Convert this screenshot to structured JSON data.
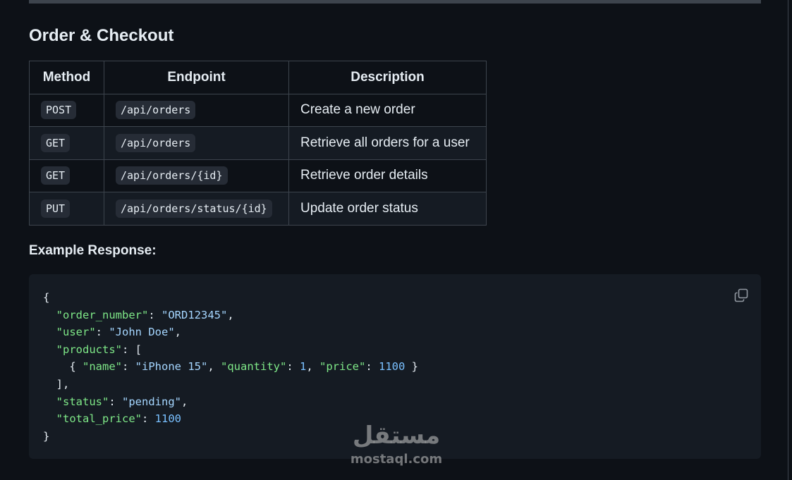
{
  "section": {
    "title": "Order & Checkout"
  },
  "table": {
    "headers": [
      "Method",
      "Endpoint",
      "Description"
    ],
    "rows": [
      {
        "method": "POST",
        "endpoint": "/api/orders",
        "description": "Create a new order"
      },
      {
        "method": "GET",
        "endpoint": "/api/orders",
        "description": "Retrieve all orders for a user"
      },
      {
        "method": "GET",
        "endpoint": "/api/orders/{id}",
        "description": "Retrieve order details"
      },
      {
        "method": "PUT",
        "endpoint": "/api/orders/status/{id}",
        "description": "Update order status"
      }
    ]
  },
  "example": {
    "label": "Example Response:",
    "code": {
      "open_brace": "{",
      "order_number_key": "\"order_number\"",
      "order_number_val": "\"ORD12345\"",
      "user_key": "\"user\"",
      "user_val": "\"John Doe\"",
      "products_key": "\"products\"",
      "product_name_key": "\"name\"",
      "product_name_val": "\"iPhone 15\"",
      "product_qty_key": "\"quantity\"",
      "product_qty_val": "1",
      "product_price_key": "\"price\"",
      "product_price_val": "1100",
      "status_key": "\"status\"",
      "status_val": "\"pending\"",
      "total_key": "\"total_price\"",
      "total_val": "1100",
      "close_brace": "}"
    },
    "copy_icon": "copy-icon"
  },
  "watermark": {
    "arabic": "مستقل",
    "latin": "mostaql.com"
  },
  "colors": {
    "background": "#0d1117",
    "border": "#3d444d",
    "code_bg": "#151b23",
    "json_key": "#7ee787",
    "json_string": "#a5d6ff",
    "json_number": "#79c0ff"
  }
}
